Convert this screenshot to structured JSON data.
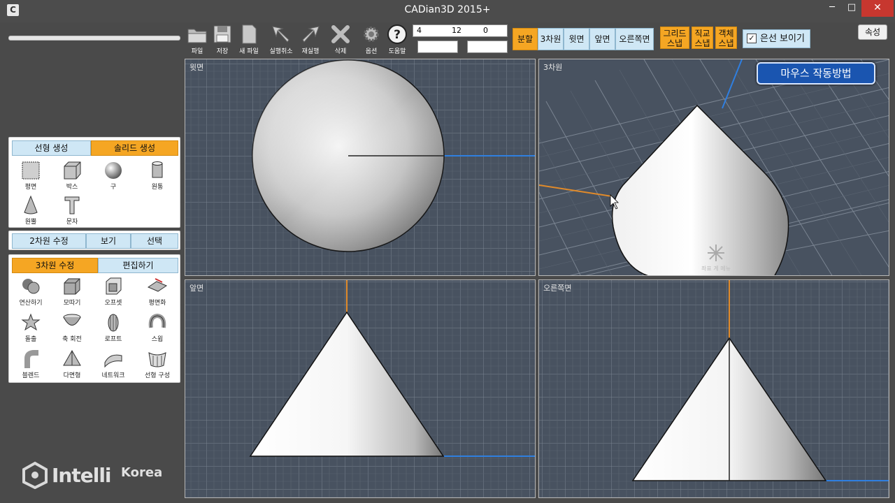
{
  "window": {
    "title": "CADian3D 2015+",
    "minimize": "─",
    "maximize": "□",
    "close": "✕"
  },
  "toolbar": {
    "tools": [
      {
        "name": "open-folder-icon",
        "label": "파일"
      },
      {
        "name": "save-icon",
        "label": "저장"
      },
      {
        "name": "new-file-icon",
        "label": "새 파일"
      },
      {
        "name": "undo-icon",
        "label": "실행취소"
      },
      {
        "name": "redo-icon",
        "label": "재실행"
      },
      {
        "name": "delete-icon",
        "label": "삭제"
      },
      {
        "name": "options-gear-icon",
        "label": "옵션"
      },
      {
        "name": "help-icon",
        "label": "도움말"
      }
    ],
    "coords": {
      "x": "4",
      "y": "12",
      "z": "0"
    },
    "view_buttons": {
      "split": "분할",
      "view3d": "3차원",
      "top": "윗면",
      "front": "앞면",
      "right": "오른쪽면"
    },
    "snap_buttons": {
      "grid": [
        "그리드",
        "스냅"
      ],
      "ortho": [
        "직교",
        "스냅"
      ],
      "object": [
        "객체",
        "스냅"
      ]
    },
    "hidden_line": {
      "label": "은선 보이기",
      "checked": true,
      "mark": "✓"
    },
    "properties": "속성"
  },
  "panels": {
    "create": {
      "tabs": [
        "선형 생성",
        "솔리드 생성"
      ],
      "active": 1,
      "items": [
        "평면",
        "박스",
        "구",
        "원통",
        "원뿔",
        "문자"
      ]
    },
    "modify2d": {
      "tabs": [
        "2차원 수정",
        "보기",
        "선택"
      ]
    },
    "modify3d": {
      "tabs": [
        "3차원 수정",
        "편집하기"
      ],
      "active": 0,
      "items": [
        "연산하기",
        "모따기",
        "오프셋",
        "평면화",
        "돌출",
        "축 회전",
        "로프트",
        "스윕",
        "블렌드",
        "다면형",
        "네트워크",
        "선형 구성"
      ]
    }
  },
  "logo": {
    "brand": "Intelli",
    "suffix": "Korea"
  },
  "viewports": {
    "top": {
      "label": "윗면"
    },
    "view3d": {
      "label": "3차원",
      "mouse_button": "마우스 작동방법",
      "watermark": "좌표 계 메뉴"
    },
    "front": {
      "label": "앞면"
    },
    "right": {
      "label": "오른쪽면"
    }
  },
  "colors": {
    "orange_active": "#f5a623",
    "blue_idle": "#cfe7f5",
    "viewport_bg": "#485260",
    "axis_blue": "#2f7fe0",
    "axis_orange": "#e08a2a"
  }
}
